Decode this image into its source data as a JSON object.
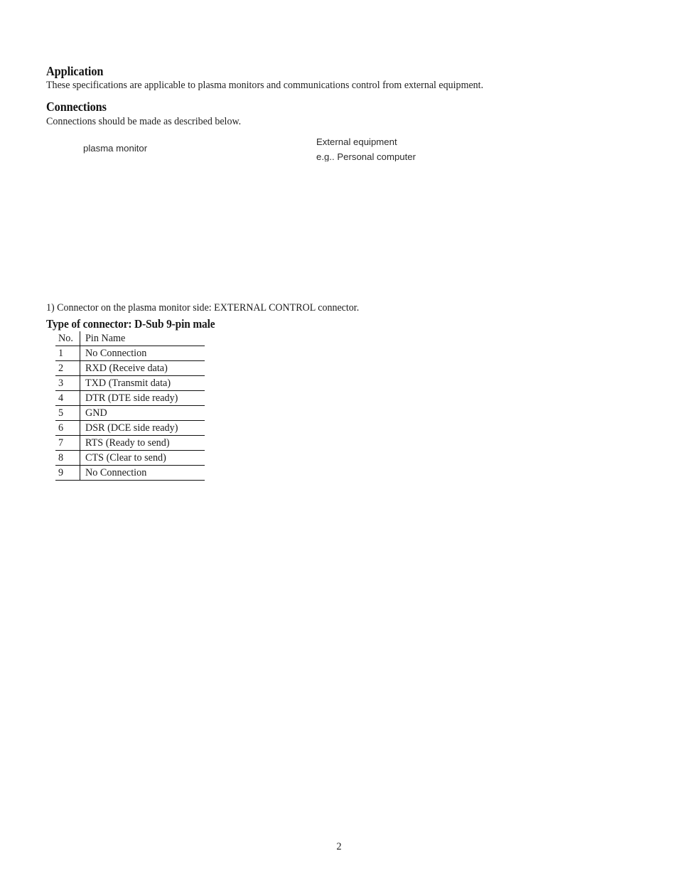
{
  "document": {
    "page_number": "2"
  },
  "sections": {
    "application": {
      "heading": "Application",
      "body": "These specifications are applicable to plasma monitors and communications control from external equipment."
    },
    "connections": {
      "heading": "Connections",
      "body": "Connections should be made as described below."
    }
  },
  "diagram": {
    "labels": {
      "left": "plasma monitor",
      "right_line1": "External equipment",
      "right_line2": "e.g.. Personal computer"
    }
  },
  "connector": {
    "note": "1) Connector on the plasma monitor side: EXTERNAL CONTROL connector.",
    "subheading": "Type of connector: D-Sub 9-pin male",
    "table": {
      "headers": [
        "No.",
        "Pin Name"
      ],
      "rows": [
        {
          "no": "1",
          "name": "No Connection"
        },
        {
          "no": "2",
          "name": "RXD (Receive data)"
        },
        {
          "no": "3",
          "name": "TXD (Transmit data)"
        },
        {
          "no": "4",
          "name": "DTR (DTE side ready)"
        },
        {
          "no": "5",
          "name": "GND"
        },
        {
          "no": "6",
          "name": "DSR (DCE side ready)"
        },
        {
          "no": "7",
          "name": "RTS (Ready to send)"
        },
        {
          "no": "8",
          "name": "CTS (Clear to send)"
        },
        {
          "no": "9",
          "name": "No Connection"
        }
      ]
    }
  },
  "colors": {
    "page_background": "#ffffff",
    "text": "#1a1a1a",
    "rule": "#111111"
  }
}
